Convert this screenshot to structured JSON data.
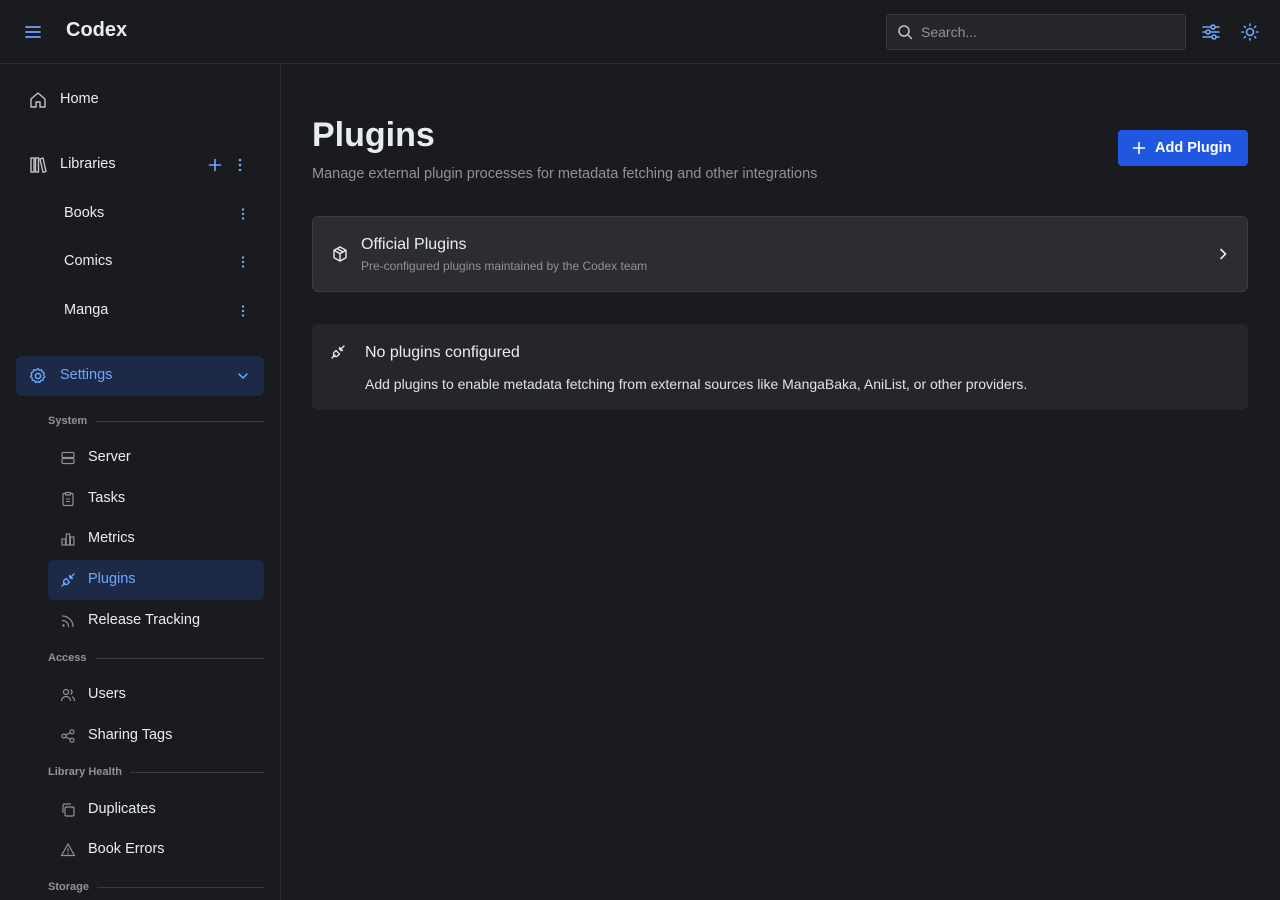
{
  "header": {
    "app_title": "Codex",
    "search_placeholder": "Search...",
    "accent": "#6ea8fe"
  },
  "sidebar": {
    "home_label": "Home",
    "libraries_label": "Libraries",
    "libraries": [
      {
        "label": "Books"
      },
      {
        "label": "Comics"
      },
      {
        "label": "Manga"
      }
    ],
    "settings_label": "Settings",
    "sections": {
      "system": "System",
      "access": "Access",
      "library_health": "Library Health",
      "storage": "Storage"
    },
    "system_items": [
      {
        "label": "Server",
        "icon": "server-icon"
      },
      {
        "label": "Tasks",
        "icon": "clipboard-icon"
      },
      {
        "label": "Metrics",
        "icon": "bar-chart-icon"
      },
      {
        "label": "Plugins",
        "icon": "plug-icon",
        "active": true
      },
      {
        "label": "Release Tracking",
        "icon": "rss-icon"
      }
    ],
    "access_items": [
      {
        "label": "Users",
        "icon": "users-icon"
      },
      {
        "label": "Sharing Tags",
        "icon": "share-icon"
      }
    ],
    "health_items": [
      {
        "label": "Duplicates",
        "icon": "copy-icon"
      },
      {
        "label": "Book Errors",
        "icon": "warning-icon"
      }
    ]
  },
  "main": {
    "title": "Plugins",
    "subtitle": "Manage external plugin processes for metadata fetching and other integrations",
    "add_button_label": "Add Plugin",
    "official": {
      "title": "Official Plugins",
      "subtitle": "Pre-configured plugins maintained by the Codex team"
    },
    "empty": {
      "title": "No plugins configured",
      "description": "Add plugins to enable metadata fetching from external sources like MangaBaka, AniList, or other providers."
    }
  },
  "colors": {
    "background": "#1a1b1e",
    "primary_button": "#1f57e0",
    "active_nav_bg": "#1c2a47"
  }
}
